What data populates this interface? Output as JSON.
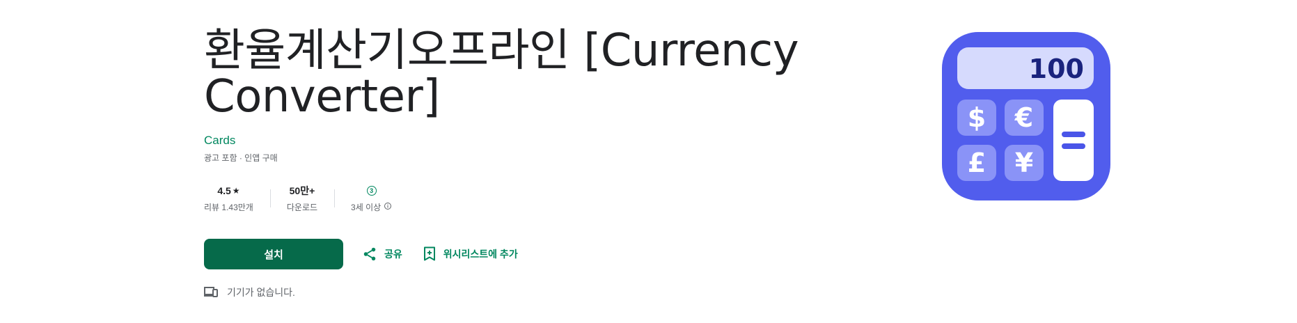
{
  "app": {
    "title_line1": "환율계산기오프라인 [Currency",
    "title_line2": "Converter]",
    "developer": "Cards",
    "subinfo": "광고 포함 · 인앱 구매",
    "icon_display_value": "100"
  },
  "stats": {
    "rating_value": "4.5",
    "rating_star": "★",
    "reviews_label": "리뷰 1.43만개",
    "downloads_value": "50만+",
    "downloads_label": "다운로드",
    "age_badge": "3",
    "age_label": "3세 이상"
  },
  "actions": {
    "install_label": "설치",
    "share_label": "공유",
    "wishlist_label": "위시리스트에 추가"
  },
  "device_note": "기기가 없습니다.",
  "colors": {
    "accent_green": "#01875f",
    "install_button": "#066a4a",
    "icon_bg": "#5661f2"
  },
  "icons": [
    "share-icon",
    "bookmark-add-icon",
    "info-icon",
    "devices-icon",
    "star-icon"
  ]
}
